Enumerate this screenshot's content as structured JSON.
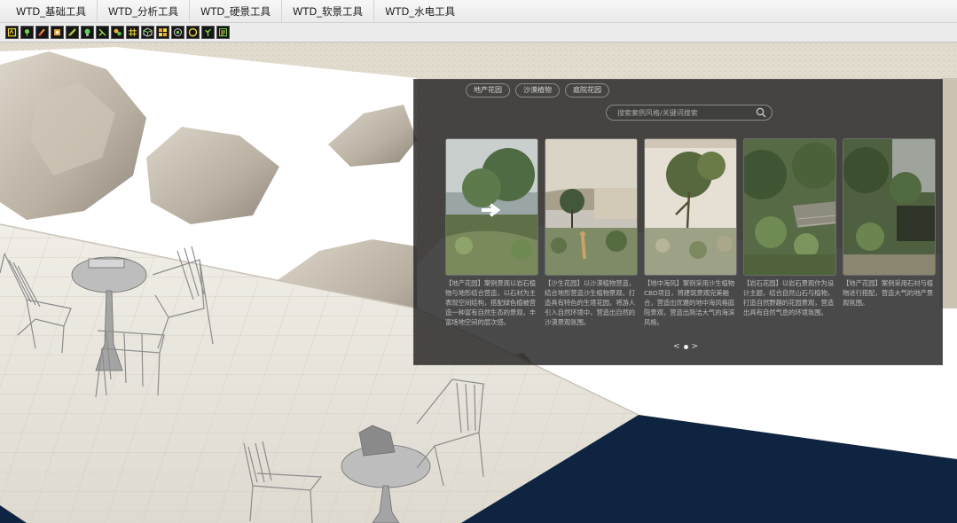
{
  "menubar": {
    "items": [
      "WTD_基础工具",
      "WTD_分析工具",
      "WTD_硬景工具",
      "WTD_软景工具",
      "WTD_水电工具"
    ]
  },
  "toolbar": {
    "buttons": [
      "layers-icon",
      "pin-icon",
      "paint-icon",
      "box-icon",
      "measure-icon",
      "bulb-icon",
      "wrench-icon",
      "tree-icon",
      "grid-icon",
      "cube-icon",
      "tiles-icon",
      "target-icon",
      "circle-icon",
      "plant-icon",
      "list-icon"
    ]
  },
  "panel": {
    "tabs": [
      "地产花园",
      "沙漠植物",
      "庭院花园"
    ],
    "search_placeholder": "搜索案例风格/关键词搜索",
    "cards": [
      {
        "desc": "【地产花园】案例景观以岩石植物与地形结合营造，以石材为主表现空间结构，搭配绿色植被营造一种富有自然生态的景观，丰富场地空间的层次感。"
      },
      {
        "desc": "【沙生花园】以沙漠植物营造，结合地形营造沙生植物景观，打造具有特色的生境花园，将游人引入自然环境中，营造出自然的沙漠景观氛围。"
      },
      {
        "desc": "【地中海风】案例采用沙生植物CBD项目，将建筑景观完美融合，营造出优雅的地中海风格庭院景观，营造出简洁大气的海滨风格。"
      },
      {
        "desc": "【岩石花园】以岩石景观作为设计主题，结合自然山石与植物，打造自然野趣的花园景观，营造出具有自然气息的环境氛围。"
      },
      {
        "desc": "【地产花园】案例采用石材与植物进行搭配，营造大气的地产景观氛围。"
      }
    ],
    "pager": {
      "prev": "<",
      "next": ">"
    }
  },
  "colors": {
    "panel_bg": "#262626",
    "text_light": "#bdbdbd",
    "sky": "#ffffff",
    "water": "#0f2440",
    "paving": "#e4e0d6"
  }
}
